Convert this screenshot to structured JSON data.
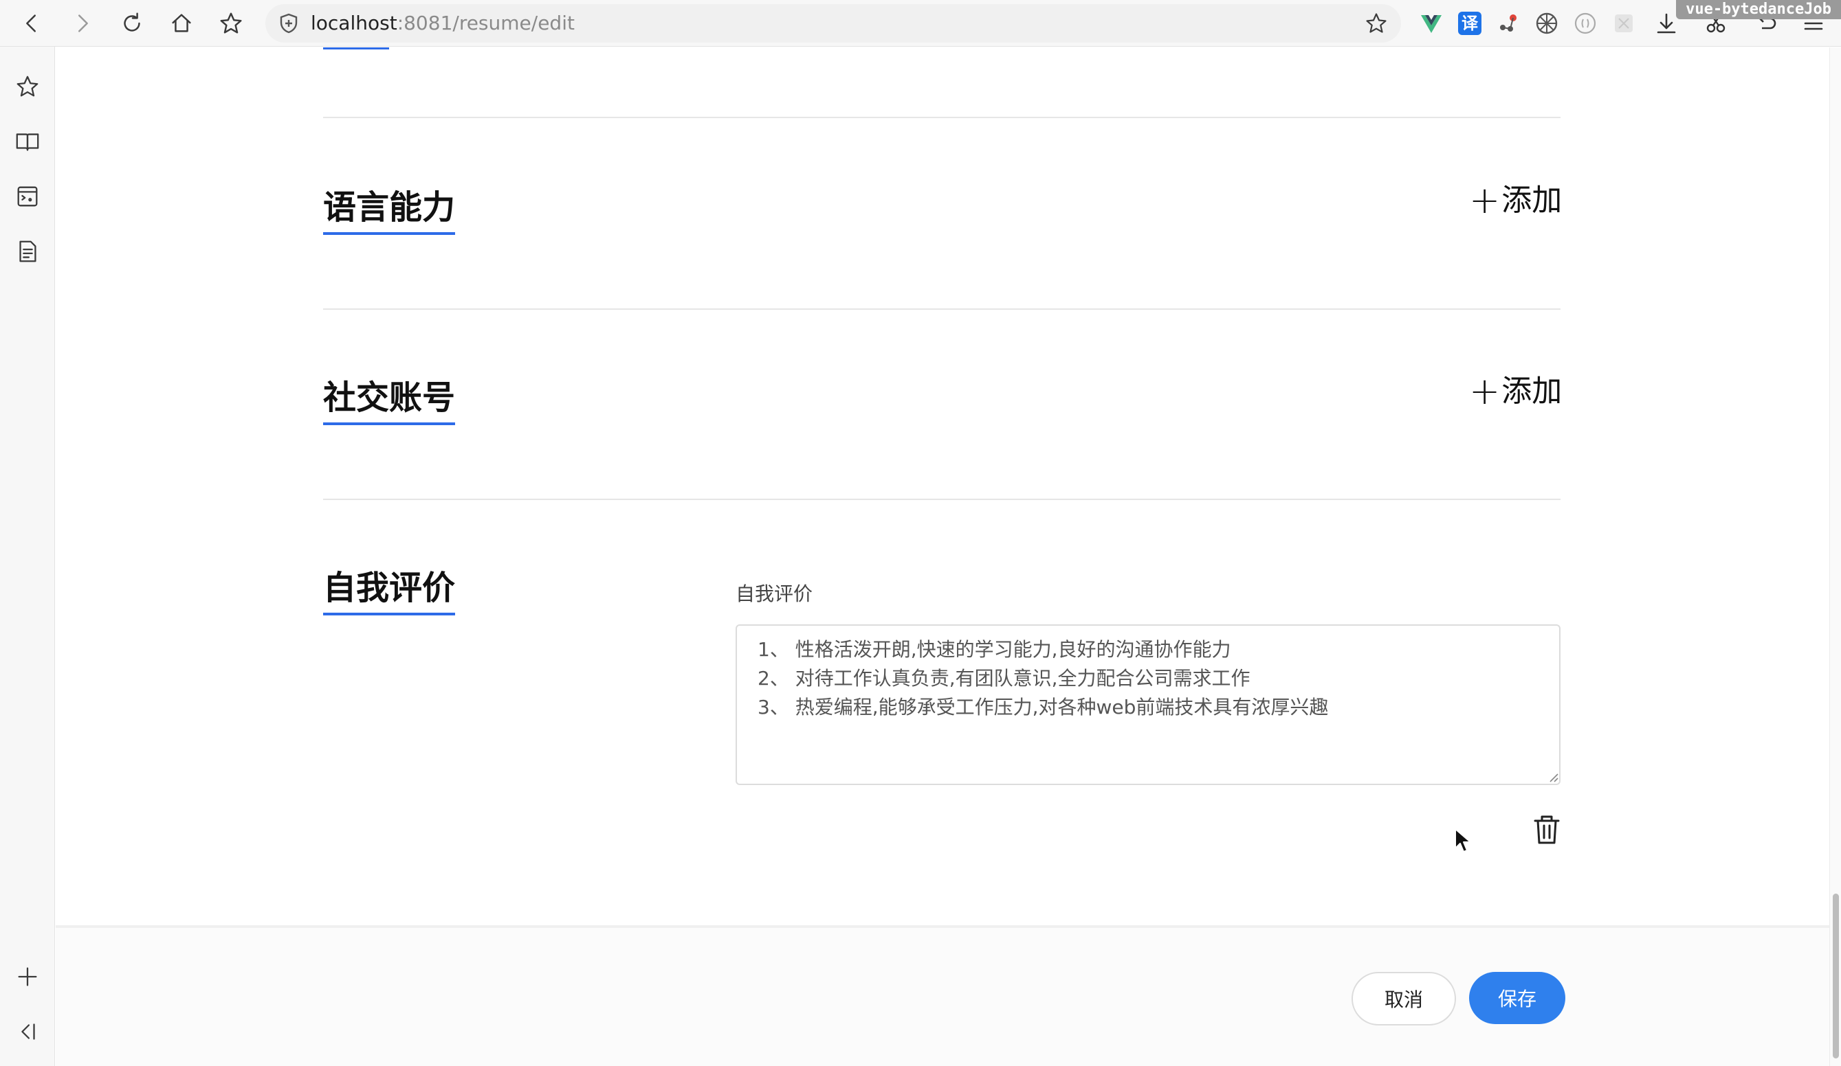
{
  "browser": {
    "url_host": "localhost",
    "url_path": ":8081/resume/edit",
    "project_badge": "vue-bytedanceJob",
    "translate_ext_label": "译"
  },
  "sections": {
    "language": {
      "title": "语言能力",
      "add_label": "添加"
    },
    "social": {
      "title": "社交账号",
      "add_label": "添加"
    },
    "self_eval": {
      "title": "自我评价",
      "field_label": "自我评价",
      "value": "1、 性格活泼开朗,快速的学习能力,良好的沟通协作能力\n2、 对待工作认真负责,有团队意识,全力配合公司需求工作\n3、 热爱编程,能够承受工作压力,对各种web前端技术具有浓厚兴趣"
    }
  },
  "footer": {
    "cancel_label": "取消",
    "save_label": "保存"
  },
  "colors": {
    "accent": "#2d6be8",
    "primary_button": "#2f80ed"
  }
}
